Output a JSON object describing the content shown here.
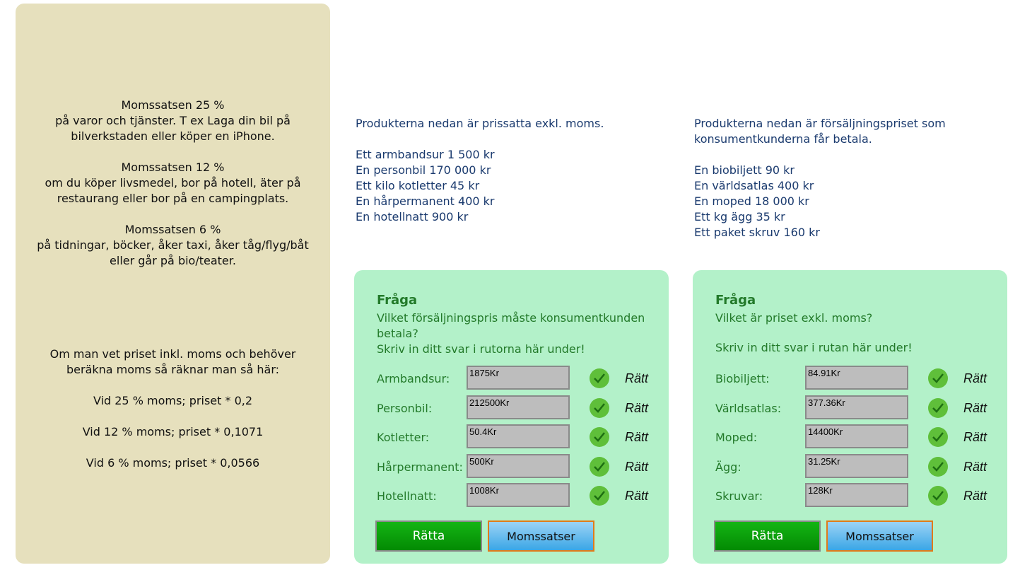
{
  "info": {
    "block1": [
      "Momssatsen 25 %",
      "på varor och tjänster. T ex Laga din bil på",
      "bilverkstaden eller köper en iPhone."
    ],
    "block2": [
      "Momssatsen 12 %",
      "om du köper livsmedel, bor på hotell, äter på",
      "restaurang eller bor på en campingplats."
    ],
    "block3": [
      "Momssatsen 6 %",
      "på tidningar, böcker, åker taxi, åker tåg/flyg/båt",
      "eller går på bio/teater."
    ],
    "block4": [
      "Om man vet priset inkl. moms och behöver",
      "beräkna moms så räknar man så här:"
    ],
    "line25": "Vid 25 % moms; priset * 0,2",
    "line12": "Vid 12 % moms; priset * 0,1071",
    "line6": "Vid 6 % moms; priset * 0,0566"
  },
  "col1": {
    "intro": "Produkterna nedan är prissatta exkl. moms.",
    "products": [
      "Ett armbandsur 1 500 kr",
      "En personbil 170 000 kr",
      "Ett kilo kotletter 45 kr",
      "En hårpermanent 400 kr",
      "En hotellnatt 900 kr"
    ]
  },
  "col2": {
    "intro": [
      "Produkterna nedan är försäljningspriset som",
      "konsumentkunderna får betala."
    ],
    "products": [
      "En biobiljett 90 kr",
      "En världsatlas 400 kr",
      "En moped 18 000 kr",
      "Ett kg ägg 35 kr",
      "Ett paket skruv 160 kr"
    ]
  },
  "quiz1": {
    "title": "Fråga",
    "question": "Vilket försäljningspris måste konsumentkunden betala?",
    "instruction": "Skriv in ditt svar i rutorna här under!",
    "rows": [
      {
        "label": "Armbandsur:",
        "value": "1875Kr",
        "result": "Rätt"
      },
      {
        "label": "Personbil:",
        "value": "212500Kr",
        "result": "Rätt"
      },
      {
        "label": "Kotletter:",
        "value": "50.4Kr",
        "result": "Rätt"
      },
      {
        "label": "Hårpermanent:",
        "value": "500Kr",
        "result": "Rätt"
      },
      {
        "label": "Hotellnatt:",
        "value": "1008Kr",
        "result": "Rätt"
      }
    ],
    "check_button": "Rätta",
    "rates_button": "Momssatser"
  },
  "quiz2": {
    "title": "Fråga",
    "question": "Vilket är priset exkl. moms?",
    "instruction": "Skriv in ditt svar i rutan här under!",
    "rows": [
      {
        "label": "Biobiljett:",
        "value": "84.91Kr",
        "result": "Rätt"
      },
      {
        "label": "Världsatlas:",
        "value": "377.36Kr",
        "result": "Rätt"
      },
      {
        "label": "Moped:",
        "value": "14400Kr",
        "result": "Rätt"
      },
      {
        "label": "Ägg:",
        "value": "31.25Kr",
        "result": "Rätt"
      },
      {
        "label": "Skruvar:",
        "value": "128Kr",
        "result": "Rätt"
      }
    ],
    "check_button": "Rätta",
    "rates_button": "Momssatser"
  },
  "colors": {
    "panel": "#e6e0bd",
    "quiz_bg": "#b3f1c9",
    "quiz_text": "#237a2a",
    "product_text": "#1a3a6e",
    "correct_icon": "#5fbf3a"
  },
  "icons": {
    "correct": "checkmark-icon"
  }
}
